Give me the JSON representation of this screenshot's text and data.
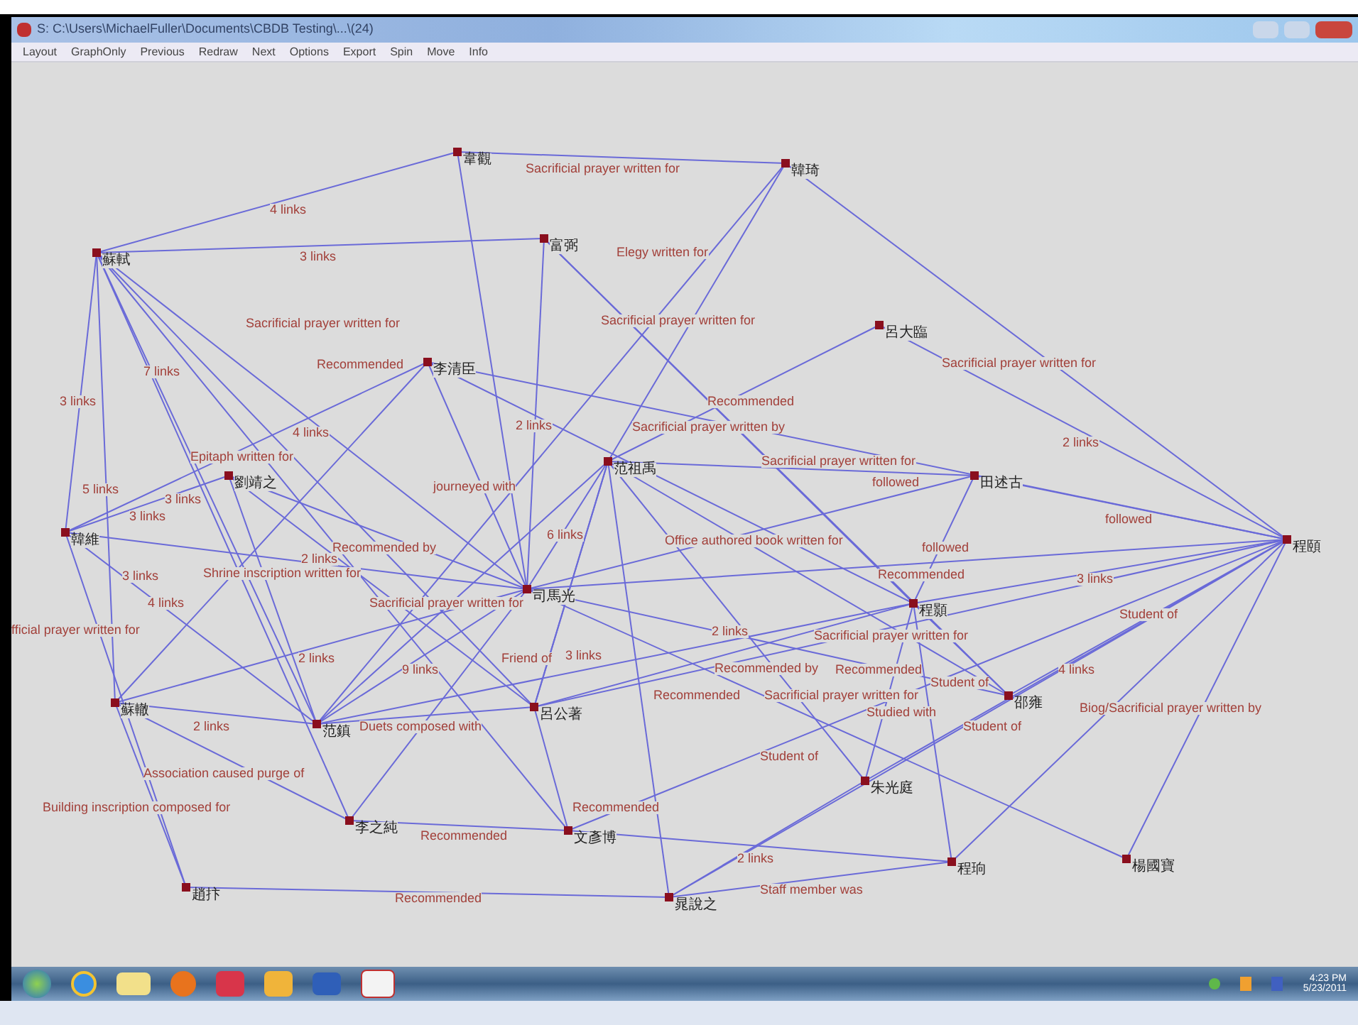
{
  "window": {
    "title": "S: C:\\Users\\MichaelFuller\\Documents\\CBDB Testing\\...\\(24)"
  },
  "menu": [
    "Layout",
    "GraphOnly",
    "Previous",
    "Redraw",
    "Next",
    "Options",
    "Export",
    "Spin",
    "Move",
    "Info"
  ],
  "graph": {
    "nodes": [
      "韋觀",
      "韓琦",
      "蘇軾",
      "富弼",
      "李清臣",
      "呂大臨",
      "范祖禹",
      "田述古",
      "程頤",
      "劉靖之",
      "韓維",
      "司馬光",
      "程顥",
      "蘇轍",
      "范鎮",
      "呂公著",
      "邵雍",
      "朱光庭",
      "李之純",
      "文彥博",
      "趙抃",
      "晁說之",
      "程珦",
      "楊國寶"
    ],
    "edge_labels": [
      "Sacrificial prayer written for",
      "4 links",
      "3 links",
      "Elegy written for",
      "Sacrificial prayer written for",
      "Sacrificial prayer written for",
      "Recommended",
      "Sacrificial prayer written for",
      "7 links",
      "3 links",
      "Recommended",
      "4 links",
      "2 links",
      "Sacrificial prayer written by",
      "2 links",
      "Epitaph written for",
      "Sacrificial prayer written for",
      "5 links",
      "journeyed with",
      "followed",
      "3 links",
      "3 links",
      "followed",
      "6 links",
      "Office authored book written for",
      "Recommended by",
      "followed",
      "2 links",
      "3 links",
      "Shrine inscription written for",
      "Recommended",
      "3 links",
      "4 links",
      "Sacrificial prayer written for",
      "Student of",
      "fficial prayer written for",
      "2 links",
      "Sacrificial prayer written for",
      "2 links",
      "Friend of",
      "3 links",
      "9 links",
      "Recommended by",
      "Recommended",
      "4 links",
      "Student of",
      "Recommended",
      "Sacrificial prayer written for",
      "Studied with",
      "Biog/Sacrificial prayer written by",
      "2 links",
      "Duets composed with",
      "Student of",
      "Student of",
      "Association caused purge of",
      "Building inscription composed for",
      "Recommended",
      "Recommended",
      "2 links",
      "Staff member was",
      "Recommended"
    ]
  },
  "taskbar": {
    "time": "4:23 PM",
    "date": "5/23/2011"
  }
}
